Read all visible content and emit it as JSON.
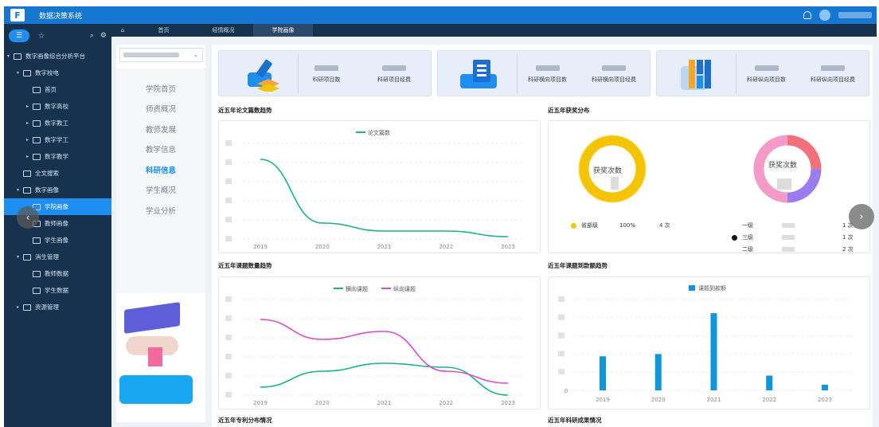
{
  "app": {
    "title": "数据决策系统"
  },
  "tabs": [
    "首页",
    "经情概况",
    "学院画像"
  ],
  "sidebar": {
    "items": [
      {
        "label": "数字画像综合分析平台",
        "level": 0,
        "caret": "▾"
      },
      {
        "label": "数字校电",
        "level": 1,
        "caret": "▾"
      },
      {
        "label": "首页",
        "level": 2,
        "caret": ""
      },
      {
        "label": "数字高校",
        "level": 2,
        "caret": "▸"
      },
      {
        "label": "数字教工",
        "level": 2,
        "caret": "▸"
      },
      {
        "label": "数字学工",
        "level": 2,
        "caret": "▸"
      },
      {
        "label": "数字教学",
        "level": 2,
        "caret": "▸"
      },
      {
        "label": "全文搜索",
        "level": 1,
        "caret": ""
      },
      {
        "label": "数字画像",
        "level": 1,
        "caret": "▾"
      },
      {
        "label": "学院画像",
        "level": 2,
        "caret": "",
        "active": true
      },
      {
        "label": "教师画像",
        "level": 2,
        "caret": ""
      },
      {
        "label": "学生画像",
        "level": 2,
        "caret": ""
      },
      {
        "label": "消生管理",
        "level": 1,
        "caret": "▾"
      },
      {
        "label": "教师数据",
        "level": 2,
        "caret": ""
      },
      {
        "label": "学生数据",
        "level": 2,
        "caret": ""
      },
      {
        "label": "资源管理",
        "level": 1,
        "caret": "▸"
      }
    ]
  },
  "subnav": {
    "items": [
      "学院首页",
      "师资概况",
      "教师发展",
      "教学信息",
      "科研信息",
      "学生概况",
      "学业分析"
    ],
    "active": "科研信息"
  },
  "stats": [
    {
      "labels": [
        "科研项目数",
        "科研项目经费"
      ]
    },
    {
      "labels": [
        "科研横向项目数",
        "科研横向项目经费"
      ]
    },
    {
      "labels": [
        "科研纵向项目数",
        "科研纵向项目经费"
      ]
    }
  ],
  "sections": {
    "s1": "近五年论文篇数趋势",
    "s2": "近五年获奖分布",
    "s3": "近五年课题数量趋势",
    "s4": "近五年课题到款额趋势",
    "s5": "近五年专利分布情况",
    "s6": "近五年科研成果情况"
  },
  "awards": {
    "donut1_label": "获奖次数",
    "donut2_label": "获奖次数",
    "legend1": {
      "name": "省部级",
      "pct": "100%",
      "count": "4 次"
    },
    "legend2": [
      {
        "name": "一级",
        "count": "1 次"
      },
      {
        "name": "三级",
        "count": "1 次"
      },
      {
        "name": "二级",
        "count": "2 次"
      }
    ]
  },
  "colors": {
    "primary": "#1677d2",
    "sidebar": "#16324f",
    "teal": "#1bb38a",
    "magenta": "#d84bd2",
    "blue": "#1296db",
    "gold": "#f5c400"
  },
  "chart_data": [
    {
      "type": "line",
      "title": "近五年论文篇数趋势",
      "x": [
        "2019",
        "2020",
        "2021",
        "2022",
        "2023"
      ],
      "series": [
        {
          "name": "论文篇数",
          "values": [
            10,
            2,
            1,
            1,
            0.3
          ]
        }
      ],
      "ylim": [
        0,
        12
      ]
    },
    {
      "type": "line",
      "title": "近五年课题数量趋势",
      "x": [
        "2019",
        "2020",
        "2021",
        "2022",
        "2023"
      ],
      "series": [
        {
          "name": "横向课题",
          "values": [
            1,
            3,
            4,
            3.5,
            0
          ]
        },
        {
          "name": "纵向课题",
          "values": [
            9.5,
            7,
            8,
            3,
            1.5
          ]
        }
      ],
      "ylim": [
        0,
        12
      ]
    },
    {
      "type": "bar",
      "title": "近五年课题到款额趋势",
      "categories": [
        "2019",
        "2020",
        "2021",
        "2022",
        "2023"
      ],
      "series": [
        {
          "name": "课题到款额",
          "values": [
            30,
            32,
            68,
            13,
            5
          ]
        }
      ],
      "ylim": [
        0,
        80
      ],
      "ytick0": "0"
    }
  ]
}
